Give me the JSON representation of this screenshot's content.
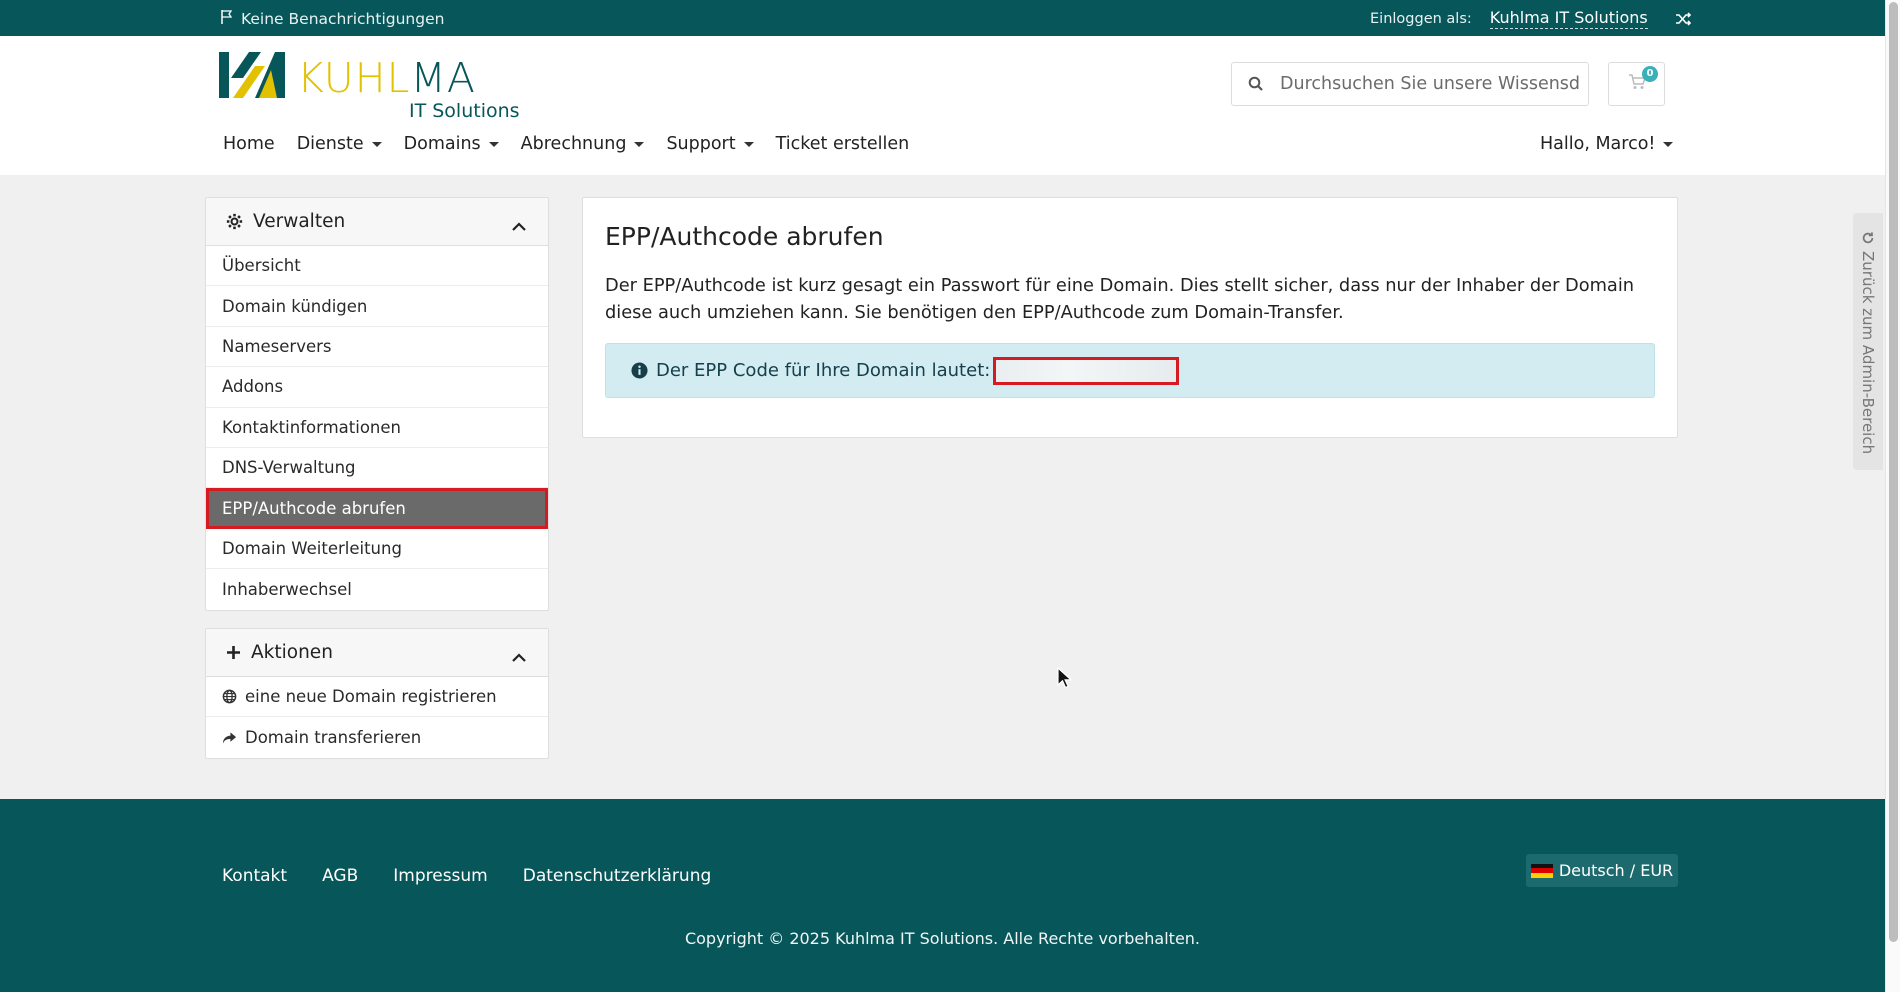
{
  "topbar": {
    "notifications": "Keine Benachrichtigungen",
    "login_label": "Einloggen als:",
    "account_name": "Kuhlma IT Solutions"
  },
  "logo": {
    "name_part1": "KUHL",
    "name_part2": "MA",
    "subtitle": "IT Solutions"
  },
  "search": {
    "placeholder": "Durchsuchen Sie unsere Wissensdatenbank..."
  },
  "cart": {
    "count": "0"
  },
  "nav": {
    "items": [
      {
        "label": "Home",
        "dropdown": false
      },
      {
        "label": "Dienste",
        "dropdown": true
      },
      {
        "label": "Domains",
        "dropdown": true
      },
      {
        "label": "Abrechnung",
        "dropdown": true
      },
      {
        "label": "Support",
        "dropdown": true
      },
      {
        "label": "Ticket erstellen",
        "dropdown": false
      }
    ],
    "user_greeting": "Hallo, Marco!"
  },
  "sidebar": {
    "manage": {
      "title": "Verwalten",
      "items": [
        "Übersicht",
        "Domain kündigen",
        "Nameservers",
        "Addons",
        "Kontaktinformationen",
        "DNS-Verwaltung",
        "EPP/Authcode abrufen",
        "Domain Weiterleitung",
        "Inhaberwechsel"
      ],
      "active_index": 6
    },
    "actions": {
      "title": "Aktionen",
      "items": [
        {
          "label": "eine neue Domain registrieren",
          "icon": "globe-icon"
        },
        {
          "label": "Domain transferieren",
          "icon": "share-arrow-icon"
        }
      ]
    }
  },
  "main": {
    "title": "EPP/Authcode abrufen",
    "description": "Der EPP/Authcode ist kurz gesagt ein Passwort für eine Domain. Dies stellt sicher, dass nur der Inhaber der Domain diese auch umziehen kann. Sie benötigen den EPP/Authcode zum Domain-Transfer.",
    "alert_text": "Der EPP Code für Ihre Domain lautet:"
  },
  "admin_tab": {
    "label": "Zurück zum Admin-Bereich"
  },
  "footer": {
    "links": [
      "Kontakt",
      "AGB",
      "Impressum",
      "Datenschutzerklärung"
    ],
    "language": "Deutsch / EUR",
    "copyright": "Copyright © 2025 Kuhlma IT Solutions. Alle Rechte vorbehalten."
  },
  "colors": {
    "brand_teal": "#07565a",
    "brand_yellow": "#e2c200",
    "highlight_red": "#d61a22",
    "alert_bg": "#d2ecf1"
  }
}
